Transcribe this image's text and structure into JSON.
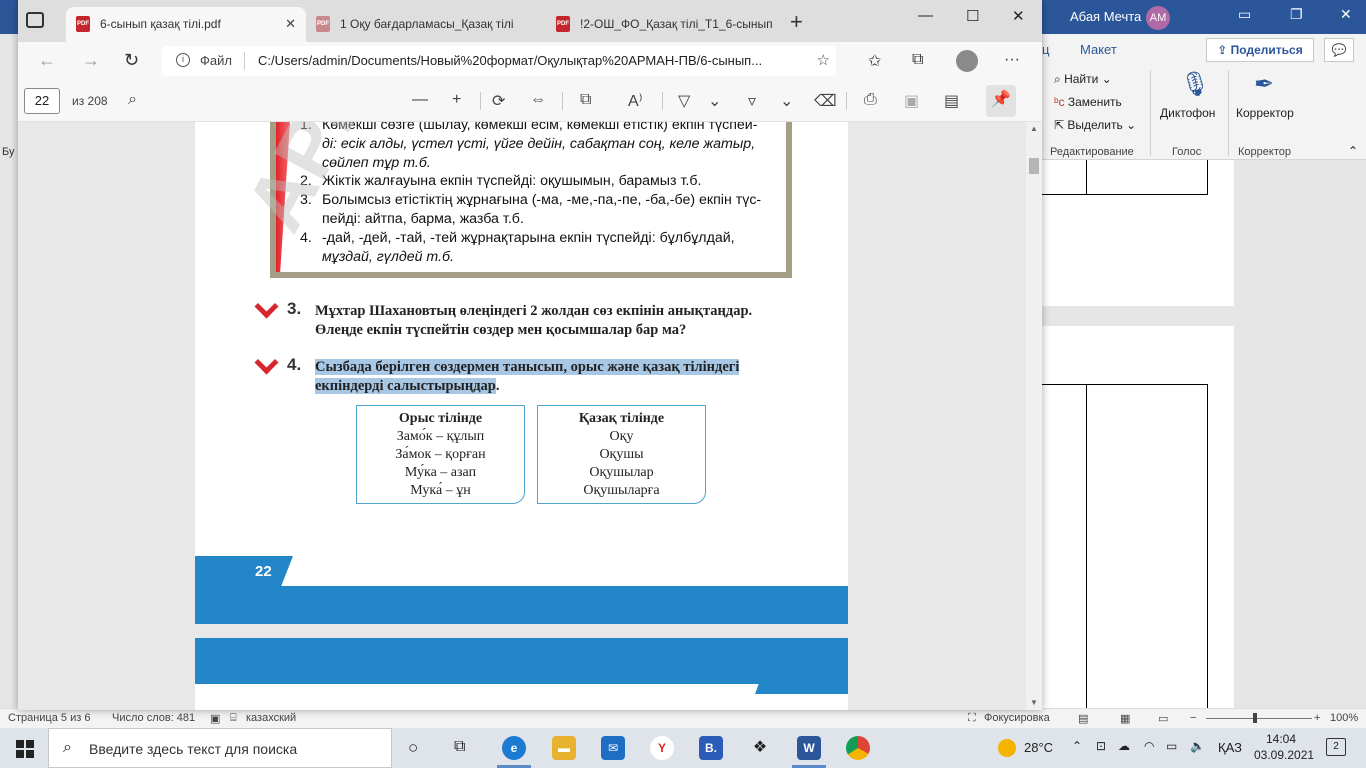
{
  "word": {
    "user_name": "Абая Мечта",
    "user_initials": "АМ",
    "ribbon_tabs": [
      "ц",
      "Макет"
    ],
    "share_label": "Поделиться",
    "ribbon": {
      "find": "Найти",
      "replace": "Заменить",
      "select": "Выделить",
      "dictate": "Диктофон",
      "editor": "Корректор",
      "group_editing": "Редактирование",
      "group_voice": "Голос",
      "group_editor": "Корректор"
    },
    "left_label": "Бу",
    "status": {
      "page": "Страница 5 из 6",
      "words": "Число слов: 481",
      "language": "казахский",
      "focus": "Фокусировка",
      "zoom": "100%"
    }
  },
  "edge": {
    "tabs": [
      {
        "label": "6-сынып қазақ тілі.pdf",
        "active": true
      },
      {
        "label": "1 Оқу бағдарламасы_Қазақ тілі",
        "active": false
      },
      {
        "label": "!2-ОШ_ФО_Қазақ тілі_Т1_6-сынып",
        "active": false
      }
    ],
    "address_label": "Файл",
    "url": "C:/Users/admin/Documents/Новый%20формат/Оқулықтар%20АРМАН-ПВ/6-сынып..."
  },
  "pdf_toolbar": {
    "page_current": "22",
    "page_total": "из 208"
  },
  "pdf": {
    "rules": [
      {
        "num": "1.",
        "lines": [
          "Көмекші сөзге (шылау, көмекші есім, көмекші етістік) екпін түспей-",
          "ді: есік алды, үстел үсті, үйге дейін, сабақтан соң, келе жатыр,",
          "сөйлеп тұр т.б."
        ]
      },
      {
        "num": "2.",
        "lines": [
          "Жіктік жалғауына екпін түспейді: оқушымын, барамыз т.б."
        ]
      },
      {
        "num": "3.",
        "lines": [
          "Болымсыз етістіктің жұрнағына (-ма, -ме,-па,-пе, -ба,-бе) екпін түс-",
          "пейді: айтпа, барма, жазба т.б."
        ]
      },
      {
        "num": "4.",
        "lines": [
          "-дай, -дей, -тай, -тей жұрнақтарына екпін түспейді: бұлбұлдай,",
          "мұздай, гүлдей т.б."
        ]
      }
    ],
    "task3": {
      "num": "3.",
      "line1": "Мұхтар Шахановтың өлеңіндегі 2 жолдан сөз екпінін анықтаңдар.",
      "line2": "Өлеңде екпін түспейтін сөздер мен қосымшалар бар ма?"
    },
    "task4": {
      "num": "4.",
      "line1": "Сызбада берілген сөздермен танысып, орыс және қазақ тіліндегі",
      "line2": "екпіндерді салыстырыңдар",
      "line2_end": "."
    },
    "russian_box": {
      "header": "Орыс тілінде",
      "rows": [
        "Замо́к – құлып",
        "За́мок – қорған",
        "Му́ка – азап",
        "Мука́ – ұн"
      ]
    },
    "kazakh_box": {
      "header": "Қазақ тілінде",
      "rows": [
        "Оқу",
        "Оқушы",
        "Оқушылар",
        "Оқушыларға"
      ]
    },
    "page_number": "22",
    "watermark": "АРМАН-ПВ"
  },
  "taskbar": {
    "search_placeholder": "Введите здесь текст для поиска",
    "temperature": "28°C",
    "language": "ҚАЗ",
    "time": "14:04",
    "date": "03.09.2021",
    "notifications": "2"
  }
}
